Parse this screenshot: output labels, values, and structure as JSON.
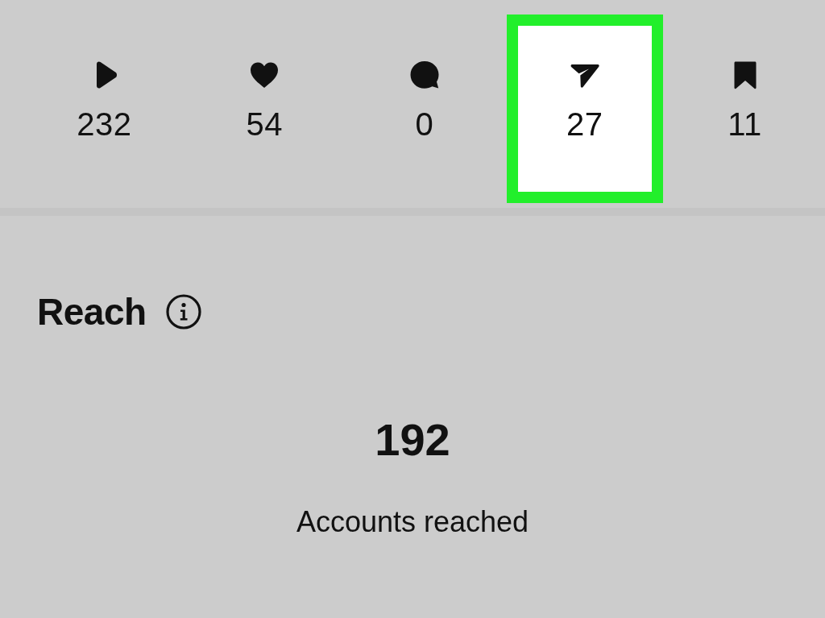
{
  "stats": [
    {
      "kind": "plays",
      "value": "232",
      "highlighted": false
    },
    {
      "kind": "likes",
      "value": "54",
      "highlighted": false
    },
    {
      "kind": "comments",
      "value": "0",
      "highlighted": false
    },
    {
      "kind": "shares",
      "value": "27",
      "highlighted": true
    },
    {
      "kind": "saves",
      "value": "11",
      "highlighted": false
    }
  ],
  "reach": {
    "title": "Reach",
    "total": "192",
    "caption": "Accounts reached"
  }
}
